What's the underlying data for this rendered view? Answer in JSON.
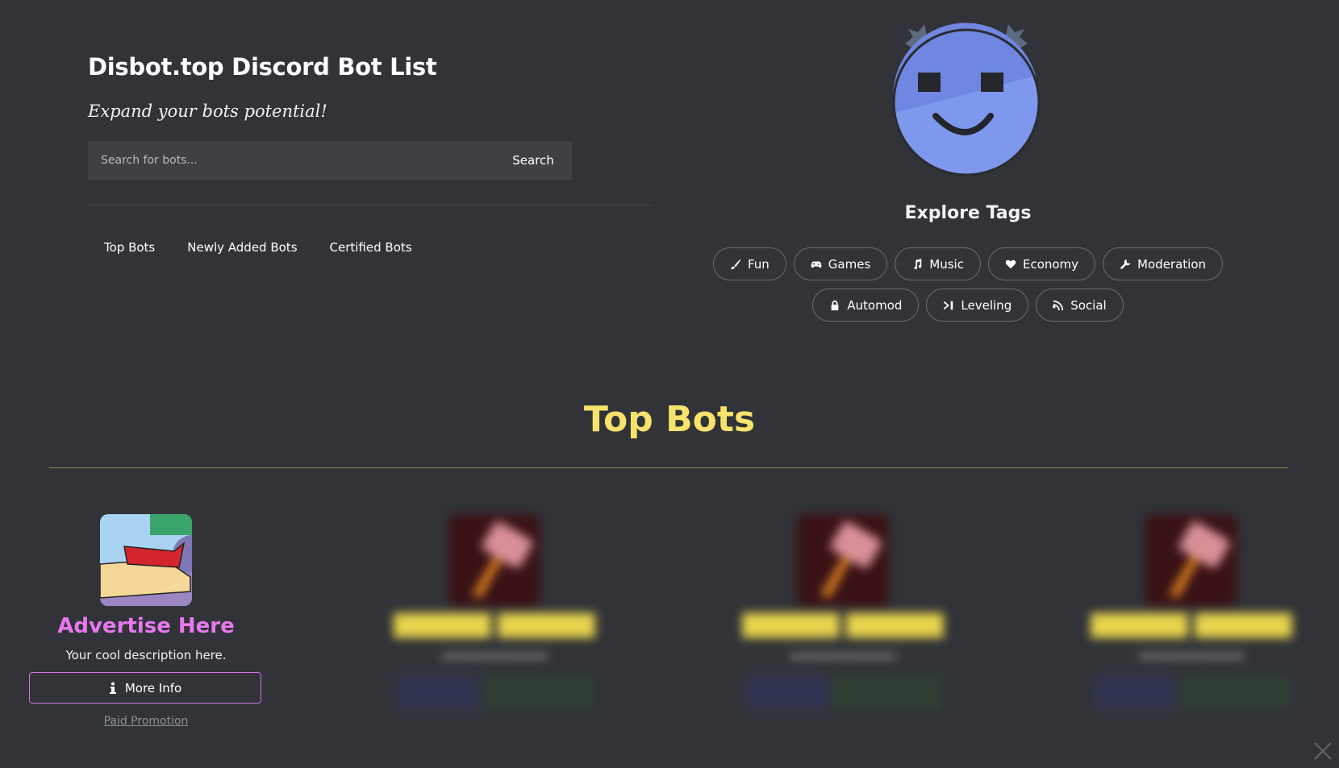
{
  "hero": {
    "title": "Disbot.top Discord Bot List",
    "tagline": "Expand your bots potential!",
    "search": {
      "placeholder": "Search for bots...",
      "button_label": "Search"
    },
    "nav": [
      {
        "label": "Top Bots"
      },
      {
        "label": "Newly Added Bots"
      },
      {
        "label": "Certified Bots"
      }
    ]
  },
  "explore": {
    "title": "Explore Tags",
    "tags": [
      {
        "label": "Fun",
        "icon": "brush-icon"
      },
      {
        "label": "Games",
        "icon": "gamepad-icon"
      },
      {
        "label": "Music",
        "icon": "music-note-icon"
      },
      {
        "label": "Economy",
        "icon": "heart-icon"
      },
      {
        "label": "Moderation",
        "icon": "wrench-icon"
      },
      {
        "label": "Automod",
        "icon": "lock-icon"
      },
      {
        "label": "Leveling",
        "icon": "skip-forward-icon"
      },
      {
        "label": "Social",
        "icon": "rss-icon"
      }
    ]
  },
  "top_bots": {
    "title": "Top Bots",
    "ad_card": {
      "name": "Advertise Here",
      "description": "Your cool description here.",
      "button_label": "More Info",
      "footer_link": "Paid Promotion"
    }
  },
  "colors": {
    "background": "#313338",
    "section_title": "#f7e26b",
    "ad_name": "#e879ef",
    "mascot": "#7e98ee"
  }
}
